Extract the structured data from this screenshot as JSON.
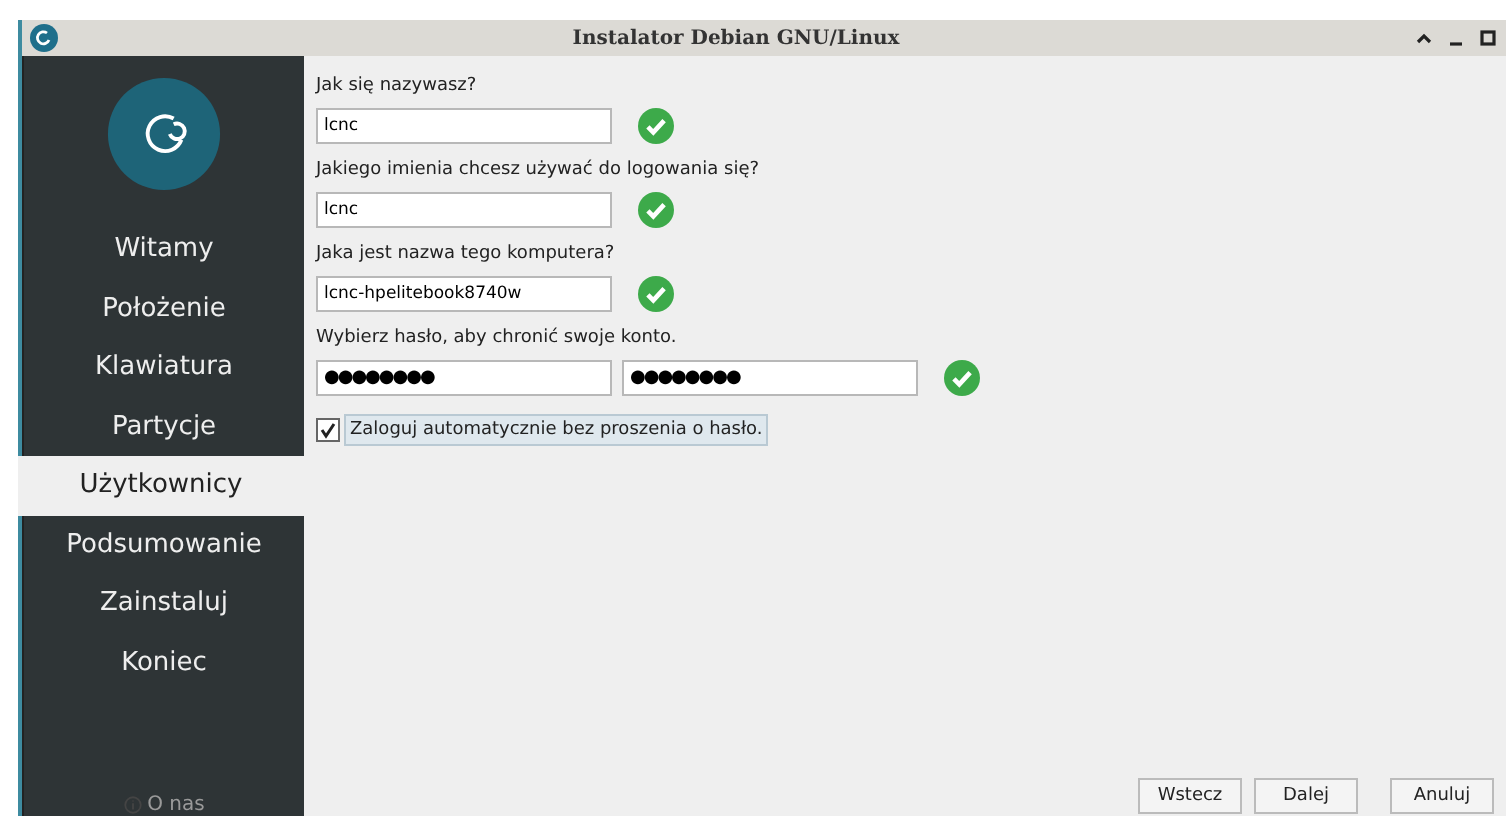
{
  "window": {
    "title": "Instalator Debian GNU/Linux"
  },
  "sidebar": {
    "items": [
      {
        "label": "Witamy",
        "selected": false
      },
      {
        "label": "Położenie",
        "selected": false
      },
      {
        "label": "Klawiatura",
        "selected": false
      },
      {
        "label": "Partycje",
        "selected": false
      },
      {
        "label": "Użytkownicy",
        "selected": true
      },
      {
        "label": "Podsumowanie",
        "selected": false
      },
      {
        "label": "Zainstaluj",
        "selected": false
      },
      {
        "label": "Koniec",
        "selected": false
      }
    ],
    "about": "O nas"
  },
  "form": [
    {
      "label": "Jak się nazywasz?",
      "fields": [
        {
          "value": "lcnc",
          "kind": "text"
        }
      ],
      "valid": true
    },
    {
      "label": "Jakiego imienia chcesz używać do logowania się?",
      "fields": [
        {
          "value": "lcnc",
          "kind": "text"
        }
      ],
      "valid": true
    },
    {
      "label": "Jaka jest nazwa tego komputera?",
      "fields": [
        {
          "value": "lcnc-hpelitebook8740w",
          "kind": "text"
        }
      ],
      "valid": true
    },
    {
      "label": "Wybierz hasło, aby chronić swoje konto.",
      "fields": [
        {
          "value": "●●●●●●●●",
          "kind": "password"
        },
        {
          "value": "●●●●●●●●",
          "kind": "password"
        }
      ],
      "valid": true
    }
  ],
  "autologin": {
    "label": "Zaloguj automatycznie bez proszenia o hasło.",
    "checked": true
  },
  "buttons": [
    "Wstecz",
    "Dalej",
    "Anuluj"
  ]
}
